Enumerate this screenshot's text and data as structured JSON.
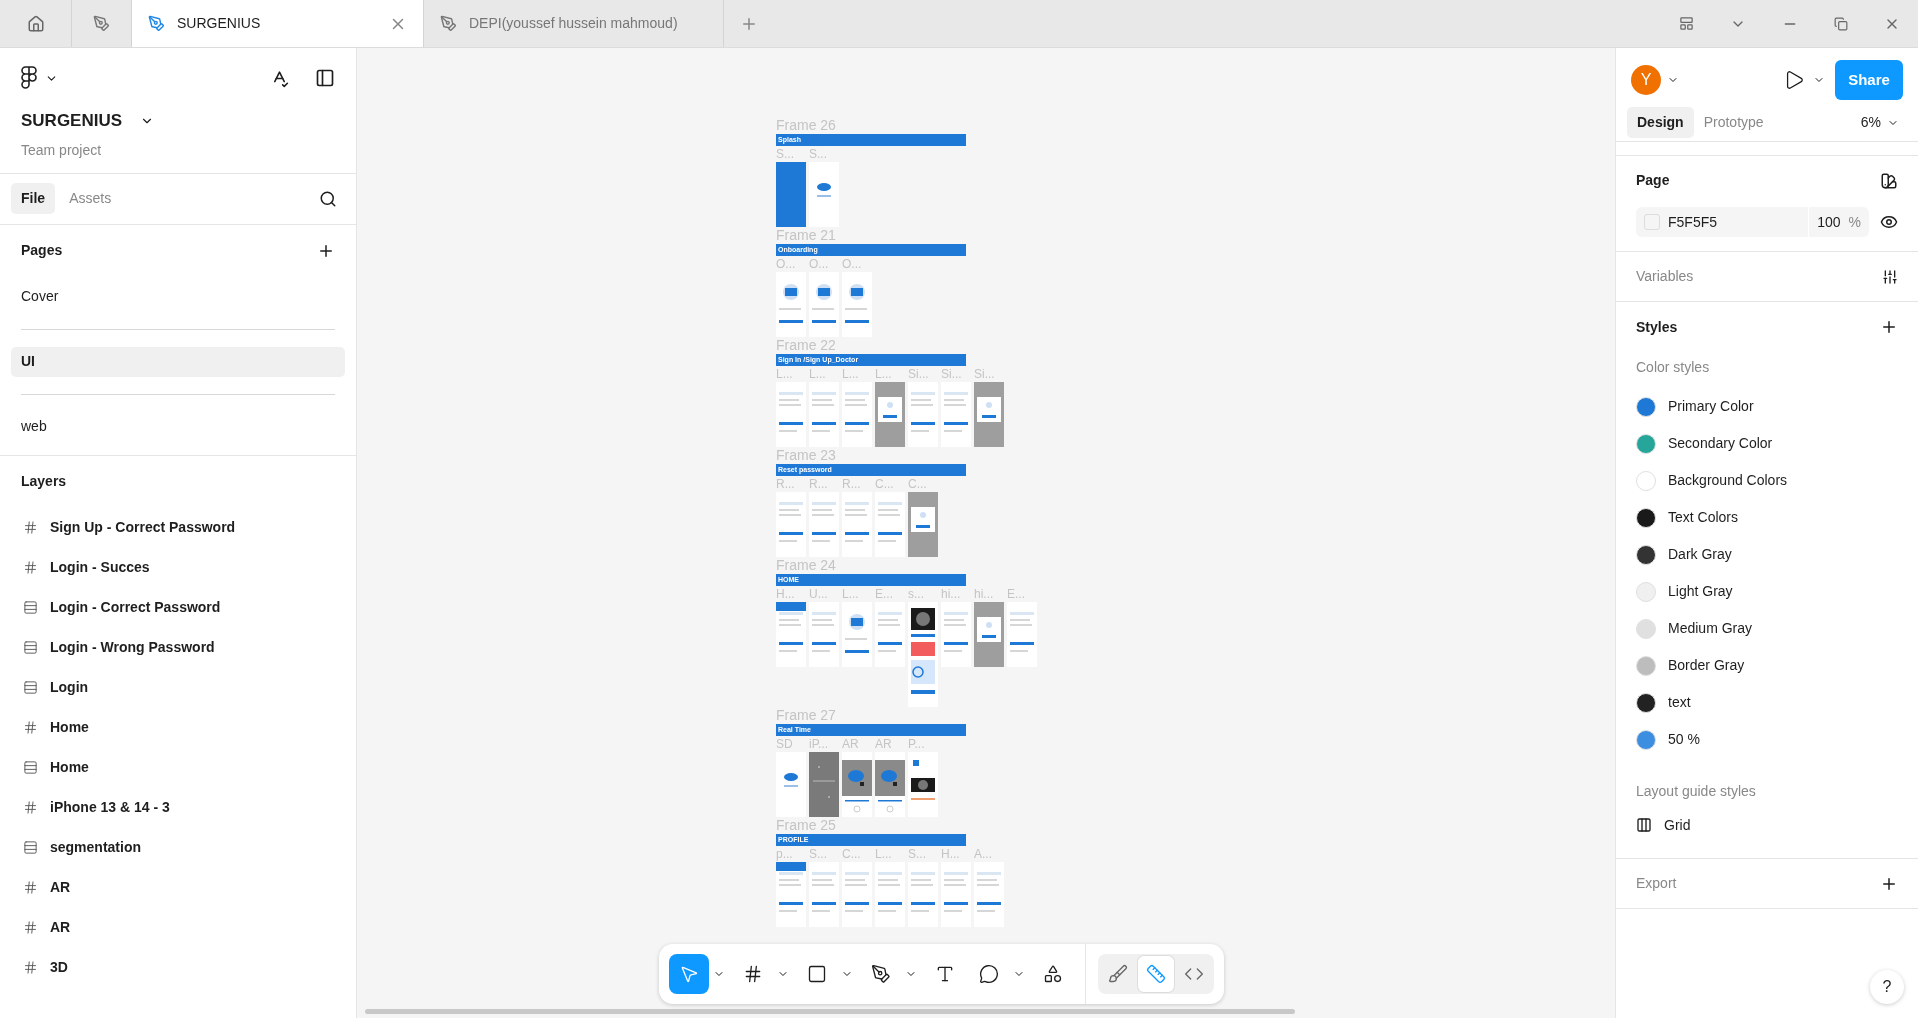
{
  "tabs": [
    {
      "kind": "home",
      "selected": false
    },
    {
      "kind": "file",
      "selected": false
    },
    {
      "kind": "file",
      "label": "SURGENIUS",
      "selected": true
    },
    {
      "kind": "file",
      "label": "DEPI(youssef hussein mahmoud)",
      "selected": false
    }
  ],
  "left_panel": {
    "project": "SURGENIUS",
    "subtitle": "Team project",
    "panel_tabs": [
      {
        "label": "File",
        "selected": true
      },
      {
        "label": "Assets",
        "selected": false
      }
    ],
    "pages_heading": "Pages",
    "pages": [
      {
        "kind": "page",
        "label": "Cover",
        "selected": false
      },
      {
        "kind": "divider"
      },
      {
        "kind": "page",
        "label": "UI",
        "selected": true
      },
      {
        "kind": "divider"
      },
      {
        "kind": "page",
        "label": "web",
        "selected": false
      }
    ],
    "layers_heading": "Layers",
    "layers": [
      {
        "kind": "frame",
        "label": "Sign Up - Correct Password"
      },
      {
        "kind": "frame",
        "label": "Login - Succes"
      },
      {
        "kind": "autolayout",
        "label": "Login - Correct Password"
      },
      {
        "kind": "autolayout",
        "label": "Login - Wrong Password"
      },
      {
        "kind": "autolayout",
        "label": "Login"
      },
      {
        "kind": "frame",
        "label": "Home"
      },
      {
        "kind": "autolayout",
        "label": "Home"
      },
      {
        "kind": "frame",
        "label": "iPhone 13 & 14 - 3"
      },
      {
        "kind": "autolayout",
        "label": "segmentation"
      },
      {
        "kind": "frame",
        "label": "AR"
      },
      {
        "kind": "frame",
        "label": "AR"
      },
      {
        "kind": "frame",
        "label": "3D"
      }
    ]
  },
  "canvas": {
    "frames": [
      {
        "label": "Frame 26",
        "section": "Splash",
        "screens": [
          {
            "label": "S...",
            "kind": "blue"
          },
          {
            "label": "S...",
            "kind": "logo"
          }
        ]
      },
      {
        "label": "Frame 21",
        "section": "Onboarding",
        "screens": [
          {
            "label": "O...",
            "kind": "illustration"
          },
          {
            "label": "O...",
            "kind": "illustration"
          },
          {
            "label": "O...",
            "kind": "illustration"
          }
        ]
      },
      {
        "label": "Frame 22",
        "section": "Sign In /Sign Up_Doctor",
        "screens": [
          {
            "label": "L...",
            "kind": "form"
          },
          {
            "label": "L...",
            "kind": "form"
          },
          {
            "label": "L...",
            "kind": "form"
          },
          {
            "label": "L...",
            "kind": "modal"
          },
          {
            "label": "Si...",
            "kind": "form"
          },
          {
            "label": "Si...",
            "kind": "form"
          },
          {
            "label": "Si...",
            "kind": "modal"
          }
        ]
      },
      {
        "label": "Frame 23",
        "section": "Reset password",
        "screens": [
          {
            "label": "R...",
            "kind": "form"
          },
          {
            "label": "R...",
            "kind": "form"
          },
          {
            "label": "R...",
            "kind": "form"
          },
          {
            "label": "C...",
            "kind": "form"
          },
          {
            "label": "C...",
            "kind": "modal"
          }
        ]
      },
      {
        "label": "Frame 24",
        "section": "HOME",
        "screens": [
          {
            "label": "H...",
            "kind": "home"
          },
          {
            "label": "U...",
            "kind": "form"
          },
          {
            "label": "L...",
            "kind": "illustration"
          },
          {
            "label": "E...",
            "kind": "form"
          },
          {
            "label": "s...",
            "kind": "scan"
          },
          {
            "label": "hi...",
            "kind": "form"
          },
          {
            "label": "hi...",
            "kind": "modal"
          },
          {
            "label": "E...",
            "kind": "form"
          }
        ]
      },
      {
        "label": "Frame 27",
        "section": "Real Time",
        "screens": [
          {
            "label": "SD",
            "kind": "logo"
          },
          {
            "label": "iP...",
            "kind": "dark"
          },
          {
            "label": "AR",
            "kind": "ar"
          },
          {
            "label": "AR",
            "kind": "ar"
          },
          {
            "label": "P...",
            "kind": "scan_short"
          }
        ]
      },
      {
        "label": "Frame 25",
        "section": "PROFILE",
        "screens": [
          {
            "label": "p...",
            "kind": "home"
          },
          {
            "label": "S...",
            "kind": "form"
          },
          {
            "label": "C...",
            "kind": "form"
          },
          {
            "label": "L...",
            "kind": "form"
          },
          {
            "label": "S...",
            "kind": "form"
          },
          {
            "label": "H...",
            "kind": "form"
          },
          {
            "label": "A...",
            "kind": "form"
          }
        ]
      }
    ]
  },
  "toolbar": {
    "tools": [
      {
        "kind": "move",
        "selected": true
      },
      {
        "kind": "frame",
        "selected": false
      },
      {
        "kind": "rectangle",
        "selected": false
      },
      {
        "kind": "pen",
        "selected": false
      },
      {
        "kind": "text",
        "selected": false
      },
      {
        "kind": "comment",
        "selected": false
      },
      {
        "kind": "actions",
        "selected": false
      }
    ],
    "modes": [
      {
        "kind": "draw",
        "selected": false
      },
      {
        "kind": "design",
        "selected": true
      },
      {
        "kind": "dev",
        "selected": false
      }
    ]
  },
  "right_panel": {
    "avatar": "Y",
    "share": "Share",
    "panel_tabs": [
      {
        "label": "Design",
        "selected": true
      },
      {
        "label": "Prototype",
        "selected": false
      }
    ],
    "zoom": "6%",
    "page_heading": "Page",
    "page_color": "F5F5F5",
    "page_opacity": "100",
    "percent": "%",
    "variables": "Variables",
    "styles_heading": "Styles",
    "color_styles_heading": "Color styles",
    "color_styles": [
      {
        "label": "Primary Color",
        "color": "#1e78d6"
      },
      {
        "label": "Secondary Color",
        "color": "#26a69a"
      },
      {
        "label": "Background Colors",
        "color": "#ffffff"
      },
      {
        "label": "Text Colors",
        "color": "#1a1a1a"
      },
      {
        "label": "Dark Gray",
        "color": "#333333"
      },
      {
        "label": "Light Gray",
        "color": "#f0f0f0"
      },
      {
        "label": "Medium Gray",
        "color": "#e0e0e0"
      },
      {
        "label": "Border Gray",
        "color": "#bdbdbd"
      },
      {
        "label": "text",
        "color": "#222222"
      },
      {
        "label": "50 %",
        "color": "#3b8ee0"
      }
    ],
    "layout_heading": "Layout guide styles",
    "layout_styles": [
      {
        "label": "Grid"
      }
    ],
    "export": "Export",
    "help": "?"
  }
}
